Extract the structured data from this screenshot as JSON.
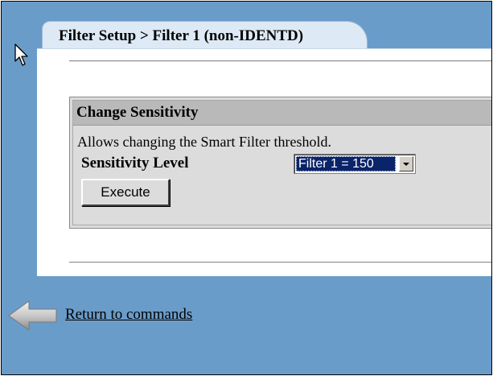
{
  "tab": {
    "title": "Filter Setup > Filter 1 (non-IDENTD)"
  },
  "section": {
    "title": "Change Sensitivity",
    "description": "Allows changing the Smart Filter threshold.",
    "sensitivity_label": "Sensitivity Level",
    "sensitivity_select": {
      "selected": "Filter 1 = 150"
    },
    "execute_label": "Execute"
  },
  "footer": {
    "return_link": "Return to commands",
    "back_icon": "back-arrow-icon"
  },
  "colors": {
    "background": "#6a9cc9",
    "tab": "#dde9f5",
    "panel": "#ffffff",
    "box_header": "#b9b9b9",
    "box": "#dcdcdc",
    "selection": "#0a246a"
  }
}
